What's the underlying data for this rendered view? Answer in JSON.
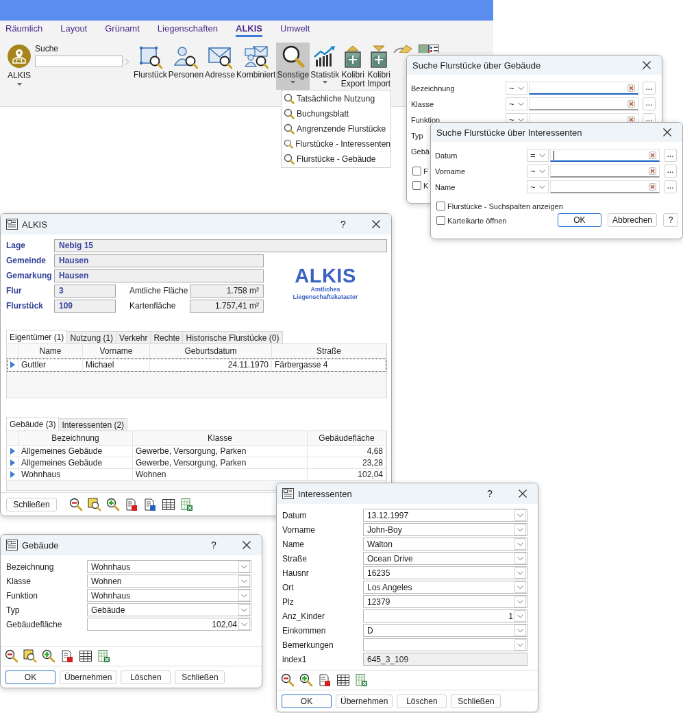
{
  "ribbon": {
    "tabs": [
      {
        "label": "Räumlich",
        "selected": false
      },
      {
        "label": "Layout",
        "selected": false
      },
      {
        "label": "Grünamt",
        "selected": false
      },
      {
        "label": "Liegenschaften",
        "selected": false
      },
      {
        "label": "ALKIS",
        "selected": true
      },
      {
        "label": "Umwelt",
        "selected": false
      }
    ],
    "app_button": {
      "label": "ALKIS"
    },
    "search": {
      "label": "Suche"
    },
    "buttons": [
      {
        "kind": "parcel",
        "label": "Flurstück",
        "pressed": false,
        "dropdown": false
      },
      {
        "kind": "person",
        "label": "Personen",
        "pressed": false,
        "dropdown": false
      },
      {
        "kind": "address",
        "label": "Adresse",
        "pressed": false,
        "dropdown": false
      },
      {
        "kind": "combined",
        "label": "Kombiniert",
        "pressed": false,
        "dropdown": false
      },
      {
        "kind": "other",
        "label": "Sonstige",
        "pressed": true,
        "dropdown": true
      },
      {
        "kind": "statistics",
        "label": "Statistik",
        "pressed": false,
        "dropdown": true
      },
      {
        "kind": "export",
        "label": "Kolibri Export",
        "pressed": false,
        "dropdown": false
      },
      {
        "kind": "import",
        "label": "Kolibri Import",
        "pressed": false,
        "dropdown": false
      },
      {
        "kind": "ruler",
        "pressed": false,
        "dropdown": false
      },
      {
        "kind": "map-list",
        "pressed": false,
        "dropdown": false
      }
    ]
  },
  "dropdown_menu": {
    "items": [
      "Tatsächliche Nutzung",
      "Buchungsblatt",
      "Angrenzende Flurstücke",
      "Flurstücke - Interessenten",
      "Flurstücke - Gebäude"
    ]
  },
  "building_search": {
    "title": "Suche Flurstücke über Gebäude",
    "fields": [
      {
        "label": "Bezeichnung",
        "operator": "~",
        "focused": true,
        "caret": false,
        "browse": "..."
      },
      {
        "label": "Klasse",
        "operator": "~",
        "focused": false,
        "caret": false,
        "browse": "..."
      },
      {
        "label": "Funktion",
        "operator": "~",
        "browse": "..."
      },
      {
        "label": "Typ"
      },
      {
        "label": "Gebä"
      }
    ],
    "checkboxes": [
      {
        "label": "F",
        "checked": false
      },
      {
        "label": "K",
        "checked": false
      }
    ]
  },
  "interest_search": {
    "title": "Suche Flurstücke über Interessenten",
    "fields": [
      {
        "label": "Datum",
        "operator": "=",
        "focused": true,
        "caret": true,
        "browse": "..."
      },
      {
        "label": "Vorname",
        "operator": "~",
        "focused": false,
        "caret": false,
        "browse": "..."
      },
      {
        "label": "Name",
        "operator": "~",
        "focused": false,
        "caret": false,
        "browse": "..."
      }
    ],
    "checkboxes": [
      {
        "label": "Flurstücke - Suchspalten anzeigen",
        "checked": false
      },
      {
        "label": "Karteikarte öffnen",
        "checked": false
      }
    ],
    "buttons": [
      {
        "label": "OK",
        "default": true
      },
      {
        "label": "Abbrechen",
        "default": false
      },
      {
        "label": "?",
        "default": false
      }
    ]
  },
  "alkis_window": {
    "title": "ALKIS",
    "help": "?",
    "fields": [
      {
        "kind": "wide",
        "label": "Lage",
        "value": "Nebig 15"
      },
      {
        "kind": "medium",
        "label": "Gemeinde",
        "value": "Hausen"
      },
      {
        "kind": "medium",
        "label": "Gemarkung",
        "value": "Hausen"
      }
    ],
    "parcel_rows": [
      {
        "label": "Flur",
        "value": "3",
        "area_label": "Amtliche Fläche",
        "area_value": "1.758 m²"
      },
      {
        "label": "Flurstück",
        "value": "109",
        "area_label": "Kartenfläche",
        "area_value": "1.757,41 m²"
      }
    ],
    "logo": {
      "title": "ALKIS",
      "subtitle": [
        "Amtliches",
        "Liegenschaftskataster"
      ]
    },
    "owner_tabs": [
      {
        "label": "Eigentümer (1)",
        "selected": true
      },
      {
        "label": "Nutzung (1)",
        "selected": false
      },
      {
        "label": "Verkehr",
        "selected": false
      },
      {
        "label": "Rechte",
        "selected": false
      },
      {
        "label": "Historische Flurstücke (0)",
        "selected": false
      }
    ],
    "owner_table": {
      "columns": [
        {
          "label": "Name",
          "kind": "text"
        },
        {
          "label": "Vorname",
          "kind": "text"
        },
        {
          "label": "Geburtsdatum",
          "kind": "number"
        },
        {
          "label": "Straße",
          "kind": "text"
        }
      ],
      "rows": [
        {
          "selected": true,
          "cells": [
            "Guttler",
            "Michael",
            "24.11.1970",
            "Färbergasse 4"
          ]
        }
      ]
    },
    "building_tabs": [
      {
        "label": "Gebäude (3)",
        "selected": true
      },
      {
        "label": "Interessenten (2)",
        "selected": false
      }
    ],
    "building_table": {
      "columns": [
        {
          "label": "Bezeichnung",
          "kind": "text"
        },
        {
          "label": "Klasse",
          "kind": "text"
        },
        {
          "label": "Gebäudefläche",
          "kind": "number"
        }
      ],
      "rows": [
        {
          "selected": false,
          "cells": [
            "Allgemeines Gebäude",
            "Gewerbe, Versorgung, Parken",
            "4,68"
          ]
        },
        {
          "selected": false,
          "cells": [
            "Allgemeines Gebäude",
            "Gewerbe, Versorgung, Parken",
            "23,28"
          ]
        },
        {
          "selected": false,
          "cells": [
            "Wohnhaus",
            "Wohnen",
            "102,04"
          ]
        }
      ]
    },
    "close_button": "Schließen",
    "toolbar": [
      {
        "kind": "zoom-out"
      },
      {
        "kind": "zoom-area"
      },
      {
        "kind": "zoom-in"
      },
      {
        "kind": "report-p"
      },
      {
        "kind": "report-r"
      },
      {
        "kind": "table"
      },
      {
        "kind": "excel"
      }
    ]
  },
  "building_window": {
    "title": "Gebäude",
    "help": "?",
    "fields": [
      {
        "label": "Bezeichnung",
        "value": "Wohnhaus",
        "kind": "combo"
      },
      {
        "label": "Klasse",
        "value": "Wohnen",
        "kind": "combo"
      },
      {
        "label": "Funktion",
        "value": "Wohnhaus",
        "kind": "combo"
      },
      {
        "label": "Typ",
        "value": "Gebäude",
        "kind": "combo"
      },
      {
        "label": "Gebäudefläche",
        "value": "102,04",
        "kind": "number"
      }
    ],
    "toolbar": [
      {
        "kind": "zoom-out"
      },
      {
        "kind": "zoom-area"
      },
      {
        "kind": "zoom-in"
      },
      {
        "kind": "report-p"
      },
      {
        "kind": "table"
      },
      {
        "kind": "excel"
      }
    ],
    "buttons": [
      {
        "label": "OK",
        "default": true
      },
      {
        "label": "Übernehmen",
        "default": false
      },
      {
        "label": "Löschen",
        "default": false
      },
      {
        "label": "Schließen",
        "default": false
      }
    ]
  },
  "interest_window": {
    "title": "Interessenten",
    "help": "?",
    "fields": [
      {
        "label": "Datum",
        "value": "13.12.1997",
        "kind": "combo"
      },
      {
        "label": "Vorname",
        "value": "John-Boy",
        "kind": "combo"
      },
      {
        "label": "Name",
        "value": "Walton",
        "kind": "combo"
      },
      {
        "label": "Straße",
        "value": "Ocean Drive",
        "kind": "combo"
      },
      {
        "label": "Hausnr",
        "value": "16235",
        "kind": "combo"
      },
      {
        "label": "Ort",
        "value": "Los Angeles",
        "kind": "combo"
      },
      {
        "label": "Plz",
        "value": "12379",
        "kind": "combo"
      },
      {
        "label": "Anz_Kinder",
        "value": "1",
        "kind": "number"
      },
      {
        "label": "Einkommen",
        "value": "D",
        "kind": "combo"
      },
      {
        "label": "Bemerkungen",
        "kind": "combo"
      },
      {
        "label": "index1",
        "value": "645_3_109",
        "kind": "readonly"
      }
    ],
    "toolbar": [
      {
        "kind": "zoom-out"
      },
      {
        "kind": "zoom-in"
      },
      {
        "kind": "report-p"
      },
      {
        "kind": "table"
      },
      {
        "kind": "excel"
      }
    ],
    "buttons": [
      {
        "label": "OK",
        "default": true
      },
      {
        "label": "Übernehmen",
        "default": false
      },
      {
        "label": "Löschen",
        "default": false
      },
      {
        "label": "Schließen",
        "default": false
      }
    ]
  }
}
